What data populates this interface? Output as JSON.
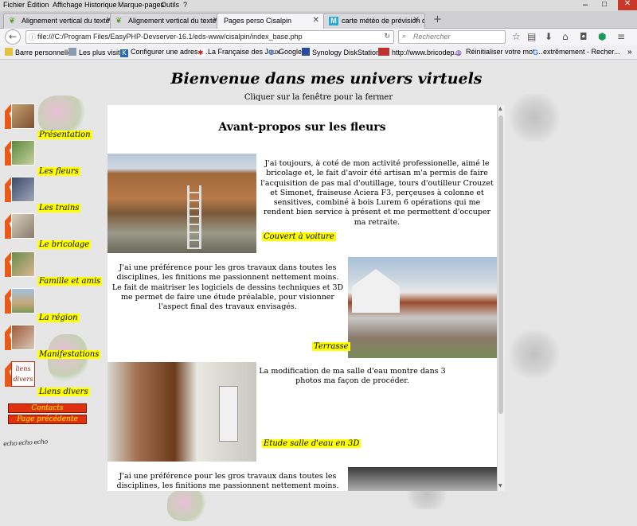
{
  "menubar": [
    "Fichier",
    "Édition",
    "Affichage",
    "Historique",
    "Marque-pages",
    "Outils",
    "?"
  ],
  "tabs": [
    {
      "title": "Alignement vertical du texte",
      "active": false
    },
    {
      "title": "Alignement vertical du texte",
      "active": false
    },
    {
      "title": "Pages perso Cisalpin",
      "active": true
    },
    {
      "title": "carte météo de prévision des",
      "active": false
    }
  ],
  "url": "file:///C:/Program Files/EasyPHP-Devserver-16.1/eds-www/cisalpin/index_base.php",
  "search_placeholder": "Rechercher",
  "bookmarks": [
    "Barre personnelle",
    "Les plus visités",
    "Configurer une adress...",
    "La Française des Jeux",
    "Google",
    "Synology DiskStation ...",
    "http://www.bricodep...",
    "Réinitialiser votre mot ...",
    "extrêmement - Recher..."
  ],
  "page": {
    "title": "Bienvenue dans mes univers virtuels",
    "close_hint": "Cliquer sur la fenêtre pour la fermer",
    "menu": [
      "Présentation",
      "Les fleurs",
      "Les trains",
      "Le bricolage",
      "Famille et amis",
      "La région",
      "Manifestations",
      "Liens divers"
    ],
    "liens_img_text": [
      "liens",
      "divers"
    ],
    "buttons": {
      "contacts": "Contacts",
      "previous": "Page précédente"
    },
    "echo_text": "echo echo echo",
    "content": {
      "heading": "Avant-propos sur les fleurs",
      "p1": "J'ai toujours, à coté de mon activité professionelle, aimé le bricolage et, le fait d'avoir été artisan m'a permis de faire l'acquisition de pas mal d'outillage, tours d'outilleur Crouzet et Simonet, fraiseuse Aciera F3, perçeuses à colonne et sensitives, combiné à bois Lurem 6 opérations qui me rendent bien service à présent et me permettent d'occuper ma retraite.",
      "cap1": "Couvert à voiture",
      "p2": "J'ai une préférence pour les gros travaux dans toutes les disciplines, les finitions me passionnent nettement moins.\nLe fait de maitriser les logiciels de dessins techniques et 3D me permet de faire une étude préalable, pour visionner l'aspect final des travaux envisagés.",
      "cap2": "Terrasse",
      "p3": "La modification de ma salle d'eau montre dans 3 photos ma façon de procéder.",
      "cap3": "Etude salle d'eau en 3D",
      "p4": "J'ai une préférence pour les gros travaux dans toutes les disciplines, les finitions me passionnent nettement moins."
    }
  }
}
